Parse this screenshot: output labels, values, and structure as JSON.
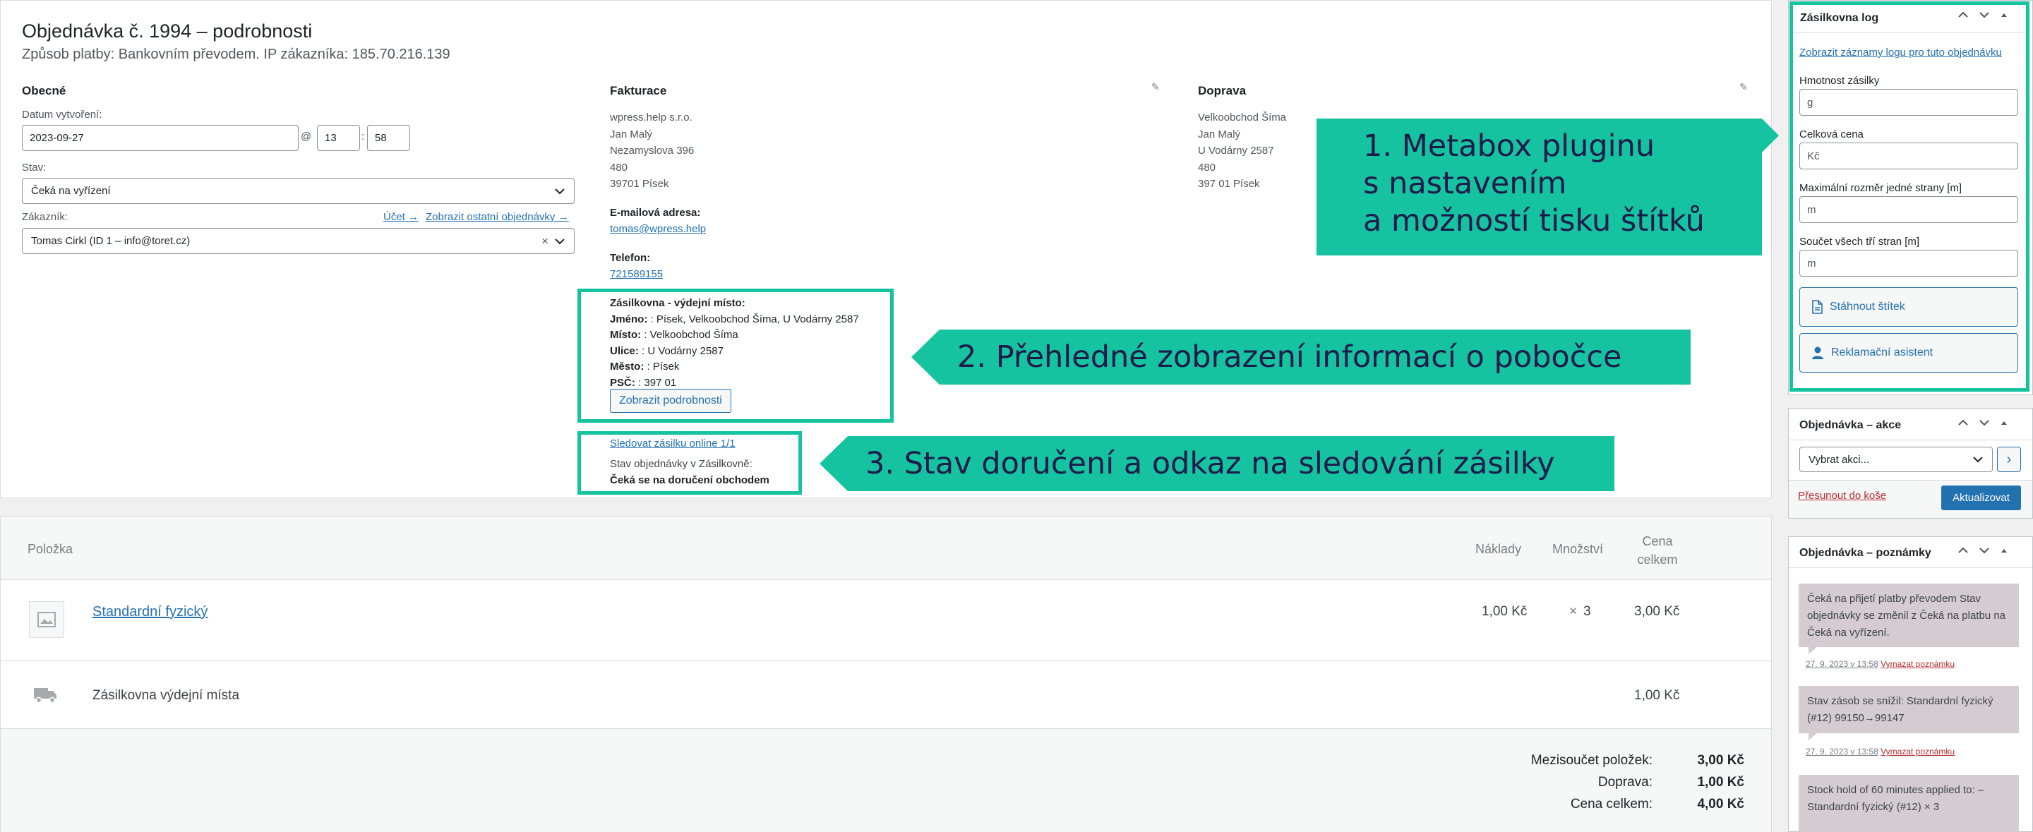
{
  "order": {
    "title": "Objednávka č. 1994 – podrobnosti",
    "subtitle": "Způsob platby: Bankovním převodem. IP zákazníka: 185.70.216.139"
  },
  "general": {
    "title": "Obecné",
    "created_label": "Datum vytvoření:",
    "date": "2023-09-27",
    "at": "@",
    "hour": "13",
    "time_sep": ":",
    "minute": "58",
    "status_label": "Stav:",
    "status": "Čeká na vyřízení",
    "customer_label": "Zákazník:",
    "account_link": "Účet →",
    "other_orders_link": "Zobrazit ostatní objednávky →",
    "customer": "Tomas Cirkl (ID 1 – info@toret.cz)",
    "clear": "×"
  },
  "billing": {
    "title": "Fakturace",
    "lines": [
      "wpress.help s.r.o.",
      "Jan Malý",
      "Nezamyslova 396",
      "480",
      "39701 Písek"
    ],
    "email_label": "E-mailová adresa:",
    "email": "tomas@wpress.help",
    "phone_label": "Telefon:",
    "phone": "721589155"
  },
  "shipping": {
    "title": "Doprava",
    "lines": [
      "Velkoobchod Šíma",
      "Jan Malý",
      "U Vodárny 2587",
      "480",
      "397 01 Písek"
    ]
  },
  "pickup": {
    "header": "Zásilkovna - výdejní místo:",
    "rows": [
      {
        "k": "Jméno:",
        "v": " : Písek, Velkoobchod Šíma, U Vodárny 2587"
      },
      {
        "k": "Místo:",
        "v": " : Velkoobchod Šíma"
      },
      {
        "k": "Ulice:",
        "v": " : U Vodárny 2587"
      },
      {
        "k": "Město:",
        "v": " : Písek"
      },
      {
        "k": "PSČ:",
        "v": " : 397 01"
      }
    ],
    "details_button": "Zobrazit podrobnosti"
  },
  "tracking": {
    "link": "Sledovat zásilku online 1/1",
    "status_label": "Stav objednávky v Zásilkovně:",
    "status": "Čeká se na doručení obchodem"
  },
  "callouts": {
    "one": [
      "1. Metabox pluginu",
      "s nastavením",
      "a možností tisku štítků"
    ],
    "two": "2. Přehledné zobrazení informací o pobočce",
    "three": "3. Stav doručení a odkaz na sledování zásilky"
  },
  "items": {
    "col_item": "Položka",
    "col_cost": "Náklady",
    "col_qty": "Množství",
    "col_total_1": "Cena",
    "col_total_2": "celkem",
    "product": {
      "name": "Standardní fyzický",
      "cost": "1,00 Kč",
      "qty_x": "×",
      "qty": "3",
      "total": "3,00 Kč"
    },
    "shipping_row": {
      "name": "Zásilkovna výdejní místa",
      "total": "1,00 Kč"
    },
    "totals": [
      {
        "label": "Mezisoučet položek:",
        "value": "3,00 Kč"
      },
      {
        "label": "Doprava:",
        "value": "1,00 Kč"
      },
      {
        "label": "Cena celkem:",
        "value": "4,00 Kč"
      }
    ]
  },
  "sidebar": {
    "log": {
      "title": "Zásilkovna log",
      "link": "Zobrazit záznamy logu pro tuto objednávku",
      "weight_label": "Hmotnost zásilky",
      "weight_ph": "g",
      "price_label": "Celková cena",
      "price_ph": "Kč",
      "maxdim_label": "Maximální rozměr jedné strany [m]",
      "maxdim_ph": "m",
      "sum_label": "Součet všech tří stran [m]",
      "sum_ph": "m",
      "download_btn": "Stáhnout štítek",
      "claim_btn": "Reklamační asistent"
    },
    "actions": {
      "title": "Objednávka – akce",
      "select": "Vybrat akci...",
      "go": "›",
      "trash": "Přesunout do koše",
      "update": "Aktualizovat"
    },
    "notes": {
      "title": "Objednávka – poznámky",
      "list": [
        {
          "text": "Čeká na přijetí platby převodem Stav objednávky se změnil z Čeká na platbu na Čeká na vyřízení.",
          "date": "27. 9. 2023 v 13:58",
          "del": "Vymazat poznámku"
        },
        {
          "text": "Stav zásob se snížil: Standardní fyzický (#12) 99150→99147",
          "date": "27. 9. 2023 v 13:58",
          "del": "Vymazat poznámku"
        },
        {
          "text": "Stock hold of 60 minutes applied to: – Standardní fyzický (#12) × 3",
          "date": "",
          "del": ""
        }
      ]
    }
  }
}
